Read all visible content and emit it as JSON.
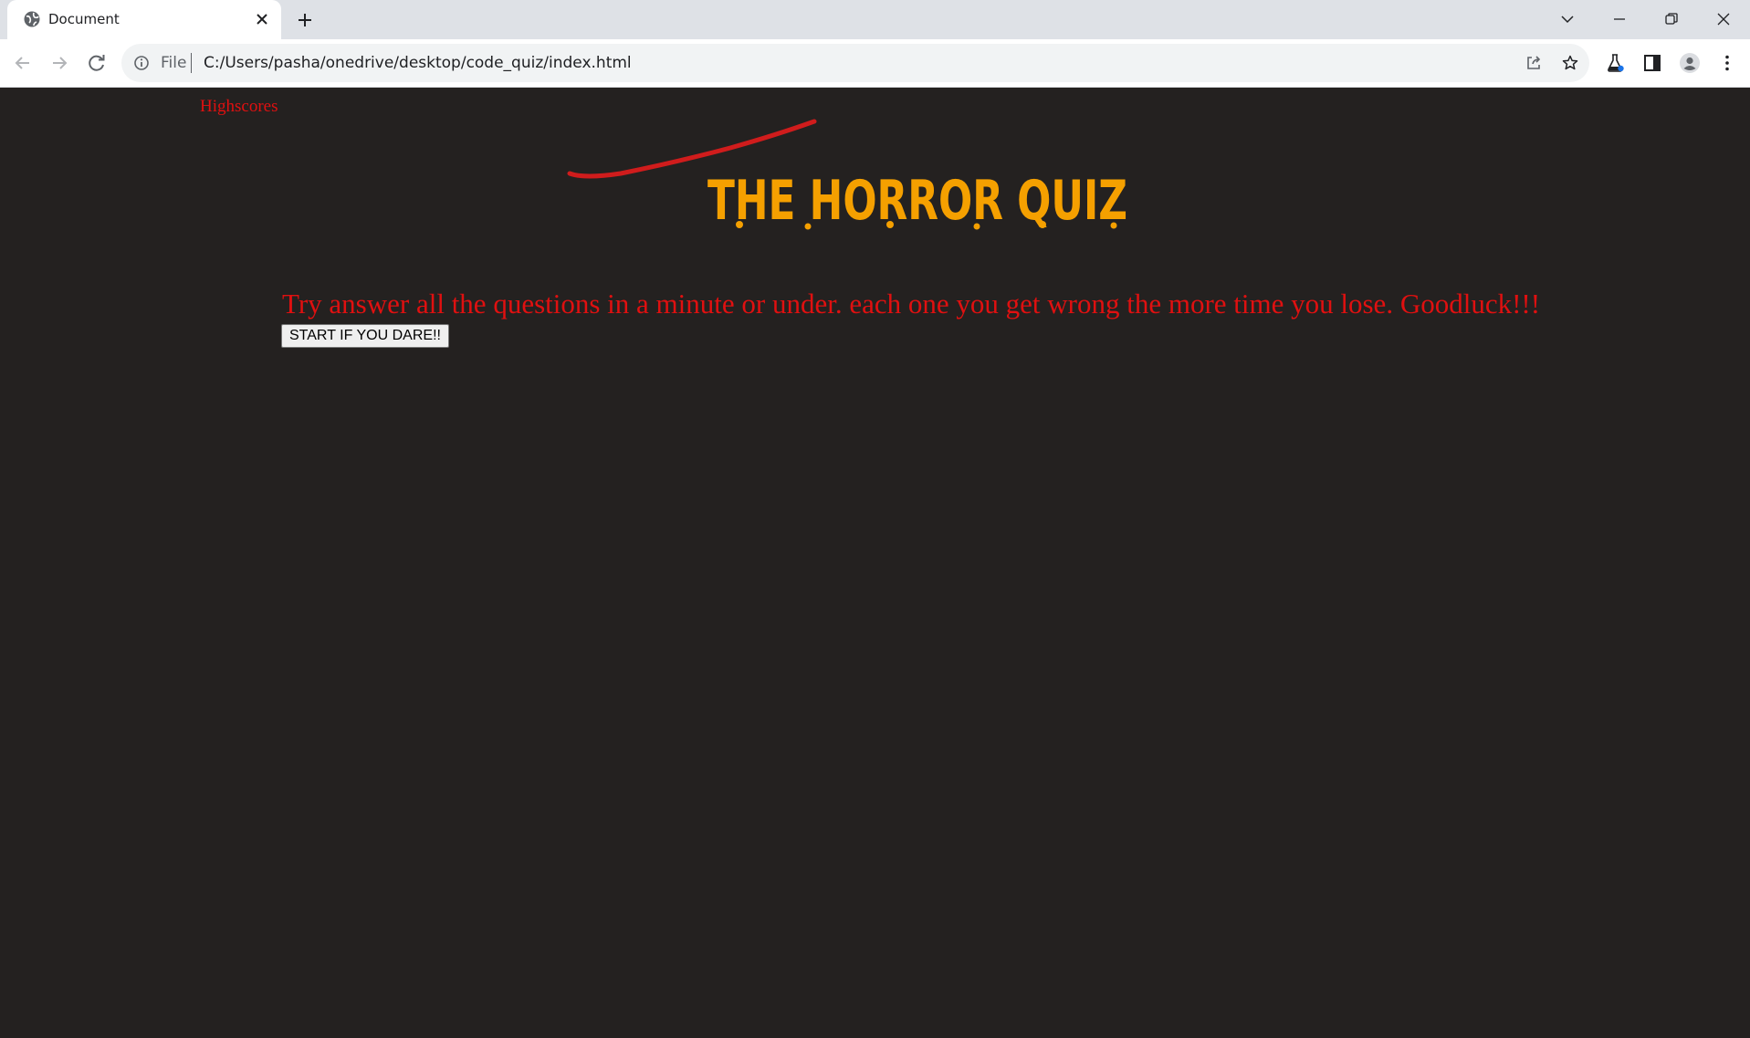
{
  "browser": {
    "tab_title": "Document",
    "scheme_label": "File",
    "url": "C:/Users/pasha/onedrive/desktop/code_quiz/index.html"
  },
  "page": {
    "highscores_link": "Highscores",
    "title": "THE HORROR QUIZ",
    "intro": "Try answer all the questions in a minute or under. each one you get wrong the more time you lose. Goodluck!!!",
    "start_button": "START IF YOU DARE!!"
  },
  "colors": {
    "page_background": "#242120",
    "text_red": "#e01010",
    "title_orange": "#f5a000"
  },
  "icons": [
    "globe-icon",
    "close-icon",
    "plus-icon",
    "chevron-down-icon",
    "minimize-icon",
    "restore-icon",
    "window-close-icon",
    "back-icon",
    "forward-icon",
    "reload-icon",
    "info-icon",
    "share-icon",
    "star-icon",
    "labs-icon",
    "side-panel-icon",
    "profile-icon",
    "menu-icon"
  ]
}
